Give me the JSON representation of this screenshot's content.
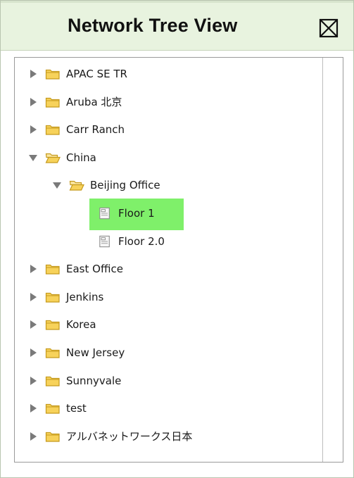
{
  "window": {
    "title": "Network Tree View"
  },
  "tree": {
    "items": [
      {
        "label": "APAC SE TR",
        "level": 0,
        "expanded": false,
        "type": "folder"
      },
      {
        "label": "Aruba 北京",
        "level": 0,
        "expanded": false,
        "type": "folder"
      },
      {
        "label": "Carr Ranch",
        "level": 0,
        "expanded": false,
        "type": "folder"
      },
      {
        "label": "China",
        "level": 0,
        "expanded": true,
        "type": "folder"
      },
      {
        "label": "Beijing Office",
        "level": 1,
        "expanded": true,
        "type": "folder"
      },
      {
        "label": "Floor 1",
        "level": 2,
        "type": "floor",
        "selected": true
      },
      {
        "label": "Floor 2.0",
        "level": 2,
        "type": "floor"
      },
      {
        "label": "East Office",
        "level": 0,
        "expanded": false,
        "type": "folder"
      },
      {
        "label": "Jenkins",
        "level": 0,
        "expanded": false,
        "type": "folder"
      },
      {
        "label": "Korea",
        "level": 0,
        "expanded": false,
        "type": "folder"
      },
      {
        "label": "New Jersey",
        "level": 0,
        "expanded": false,
        "type": "folder"
      },
      {
        "label": "Sunnyvale",
        "level": 0,
        "expanded": false,
        "type": "folder"
      },
      {
        "label": "test",
        "level": 0,
        "expanded": false,
        "type": "folder"
      },
      {
        "label": "アルバネットワークス日本",
        "level": 0,
        "expanded": false,
        "type": "folder"
      }
    ]
  },
  "colors": {
    "titlebar_bg": "#e8f3df",
    "selection": "#7ff06a",
    "folder_fill": "#f7d25a",
    "folder_stroke": "#c59a1d",
    "arrow": "#7a7a7a"
  },
  "icons": {
    "close": "close-box-icon",
    "collapsed": "triangle-right-icon",
    "expanded": "triangle-down-icon",
    "folder": "folder-icon",
    "folder_open": "folder-open-icon",
    "floor": "floor-plan-icon"
  }
}
